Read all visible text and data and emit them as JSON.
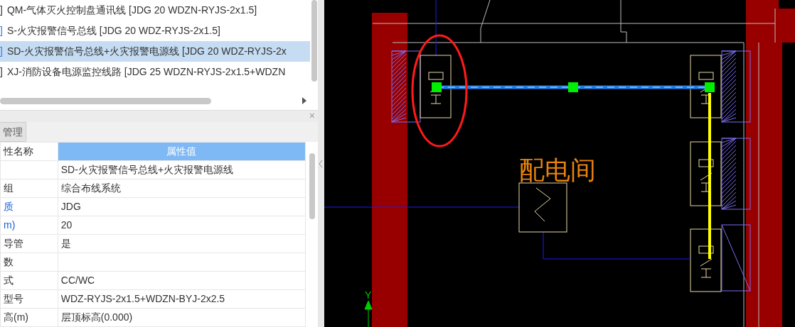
{
  "layer_list": {
    "items": [
      {
        "bracket": "]",
        "marked": false,
        "selected": false,
        "label": "QM-气体灭火控制盘通讯线 [JDG 20 WDZN-RYJS-2x1.5]"
      },
      {
        "bracket": "]",
        "marked": true,
        "selected": false,
        "label": "S-火灾报警信号总线 [JDG 20 WDZ-RYJS-2x1.5]"
      },
      {
        "bracket": "]",
        "marked": true,
        "selected": true,
        "label": "SD-火灾报警信号总线+火灾报警电源线 [JDG 20 WDZ-RYJS-2x"
      },
      {
        "bracket": "]",
        "marked": false,
        "selected": false,
        "label": "XJ-消防设备电源监控线路 [JDG 25 WDZN-RYJS-2x1.5+WDZN"
      }
    ]
  },
  "properties_panel": {
    "close": "×",
    "tabs": [
      {
        "label": "管理"
      }
    ],
    "columns": [
      "性名称",
      "属性值"
    ],
    "rows": [
      {
        "name": "",
        "value": "SD-火灾报警信号总线+火灾报警电源线"
      },
      {
        "name": "组",
        "value": "综合布线系统"
      },
      {
        "name": "质",
        "value": "JDG",
        "linked": true
      },
      {
        "name": "m)",
        "value": "20",
        "linked": true
      },
      {
        "name": "导管",
        "value": "是"
      },
      {
        "name": "数",
        "value": ""
      },
      {
        "name": "式",
        "value": "CC/WC"
      },
      {
        "name": "型号",
        "value": "WDZ-RYJS-2x1.5+WDZN-BYJ-2x2.5"
      },
      {
        "name": "高(m)",
        "value": "层顶标高(0.000)"
      }
    ]
  },
  "drawing": {
    "room_label": "配电间",
    "axis_label": "Y"
  }
}
